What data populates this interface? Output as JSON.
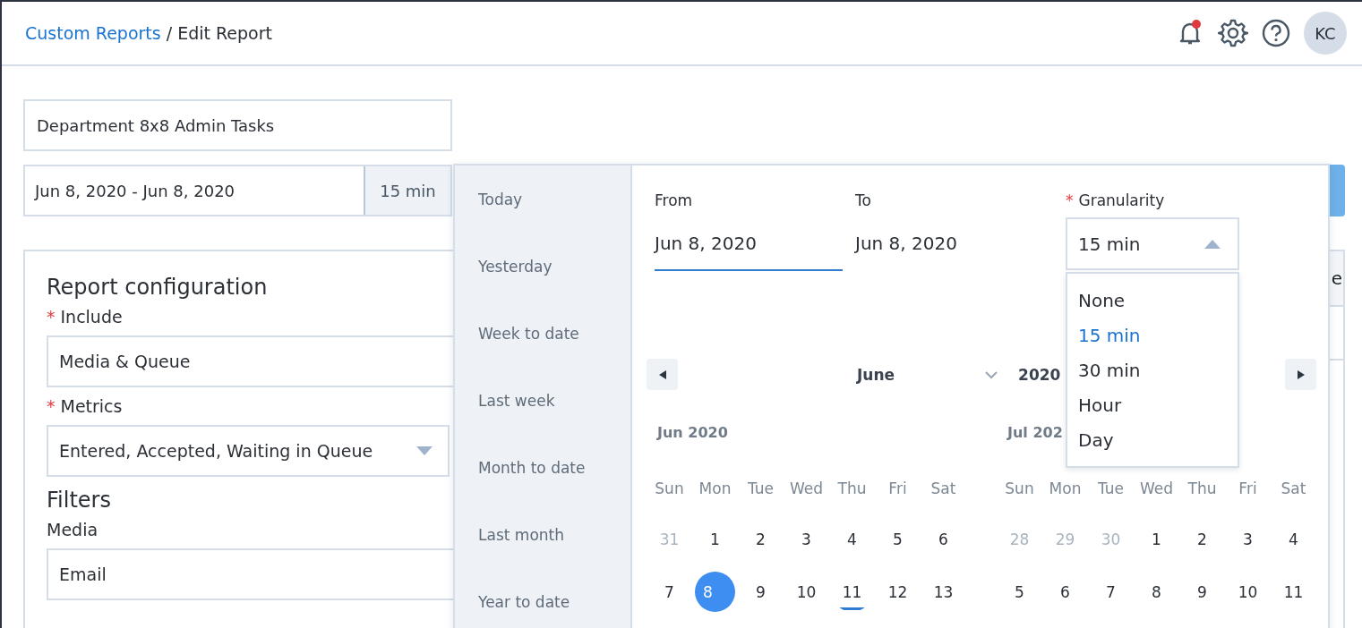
{
  "breadcrumb": {
    "link": "Custom Reports",
    "separator": "/",
    "current": "Edit Report"
  },
  "header": {
    "unread_notifications": true,
    "avatar": "KC"
  },
  "report_name": "Department 8x8 Admin Tasks",
  "date_range": {
    "value": "Jun 8, 2020 - Jun 8, 2020",
    "granularity": "15 min"
  },
  "config": {
    "title": "Report configuration",
    "include": {
      "required_marker": "*",
      "label": "Include",
      "value": "Media & Queue"
    },
    "metrics": {
      "required_marker": "*",
      "label": "Metrics",
      "value": "Entered, Accepted, Waiting in Queue"
    },
    "filters_title": "Filters",
    "media": {
      "label": "Media",
      "value": "Email"
    }
  },
  "table_header_text": "e",
  "picker": {
    "presets": [
      "Today",
      "Yesterday",
      "Week to date",
      "Last week",
      "Month to date",
      "Last month",
      "Year to date"
    ],
    "from": {
      "label": "From",
      "value": "Jun 8, 2020",
      "focused": true
    },
    "to": {
      "label": "To",
      "value": "Jun 8, 2020",
      "focused": false
    },
    "granularity": {
      "required_marker": "*",
      "label": "Granularity",
      "value": "15 min",
      "expanded": true,
      "options": [
        {
          "label": "None",
          "selected": false
        },
        {
          "label": "15 min",
          "selected": true
        },
        {
          "label": "30 min",
          "selected": false
        },
        {
          "label": "Hour",
          "selected": false
        },
        {
          "label": "Day",
          "selected": false
        }
      ]
    },
    "nav": {
      "month": "June",
      "year": "2020"
    },
    "months": [
      {
        "title": "Jun 2020",
        "weekdays": [
          "Sun",
          "Mon",
          "Tue",
          "Wed",
          "Thu",
          "Fri",
          "Sat"
        ],
        "weeks": [
          [
            {
              "day": "31",
              "outside": true,
              "selected": false,
              "today": false
            },
            {
              "day": "1",
              "outside": false,
              "selected": false,
              "today": false
            },
            {
              "day": "2",
              "outside": false,
              "selected": false,
              "today": false
            },
            {
              "day": "3",
              "outside": false,
              "selected": false,
              "today": false
            },
            {
              "day": "4",
              "outside": false,
              "selected": false,
              "today": false
            },
            {
              "day": "5",
              "outside": false,
              "selected": false,
              "today": false
            },
            {
              "day": "6",
              "outside": false,
              "selected": false,
              "today": false
            }
          ],
          [
            {
              "day": "7",
              "outside": false,
              "selected": false,
              "today": false
            },
            {
              "day": "8",
              "outside": false,
              "selected": true,
              "today": false
            },
            {
              "day": "9",
              "outside": false,
              "selected": false,
              "today": false
            },
            {
              "day": "10",
              "outside": false,
              "selected": false,
              "today": false
            },
            {
              "day": "11",
              "outside": false,
              "selected": false,
              "today": true
            },
            {
              "day": "12",
              "outside": false,
              "selected": false,
              "today": false
            },
            {
              "day": "13",
              "outside": false,
              "selected": false,
              "today": false
            }
          ]
        ]
      },
      {
        "title": "Jul 202",
        "weekdays": [
          "Sun",
          "Mon",
          "Tue",
          "Wed",
          "Thu",
          "Fri",
          "Sat"
        ],
        "weeks": [
          [
            {
              "day": "28",
              "outside": true,
              "selected": false,
              "today": false
            },
            {
              "day": "29",
              "outside": true,
              "selected": false,
              "today": false
            },
            {
              "day": "30",
              "outside": true,
              "selected": false,
              "today": false
            },
            {
              "day": "1",
              "outside": false,
              "selected": false,
              "today": false
            },
            {
              "day": "2",
              "outside": false,
              "selected": false,
              "today": false
            },
            {
              "day": "3",
              "outside": false,
              "selected": false,
              "today": false
            },
            {
              "day": "4",
              "outside": false,
              "selected": false,
              "today": false
            }
          ],
          [
            {
              "day": "5",
              "outside": false,
              "selected": false,
              "today": false
            },
            {
              "day": "6",
              "outside": false,
              "selected": false,
              "today": false
            },
            {
              "day": "7",
              "outside": false,
              "selected": false,
              "today": false
            },
            {
              "day": "8",
              "outside": false,
              "selected": false,
              "today": false
            },
            {
              "day": "9",
              "outside": false,
              "selected": false,
              "today": false
            },
            {
              "day": "10",
              "outside": false,
              "selected": false,
              "today": false
            },
            {
              "day": "11",
              "outside": false,
              "selected": false,
              "today": false
            }
          ]
        ]
      }
    ]
  }
}
